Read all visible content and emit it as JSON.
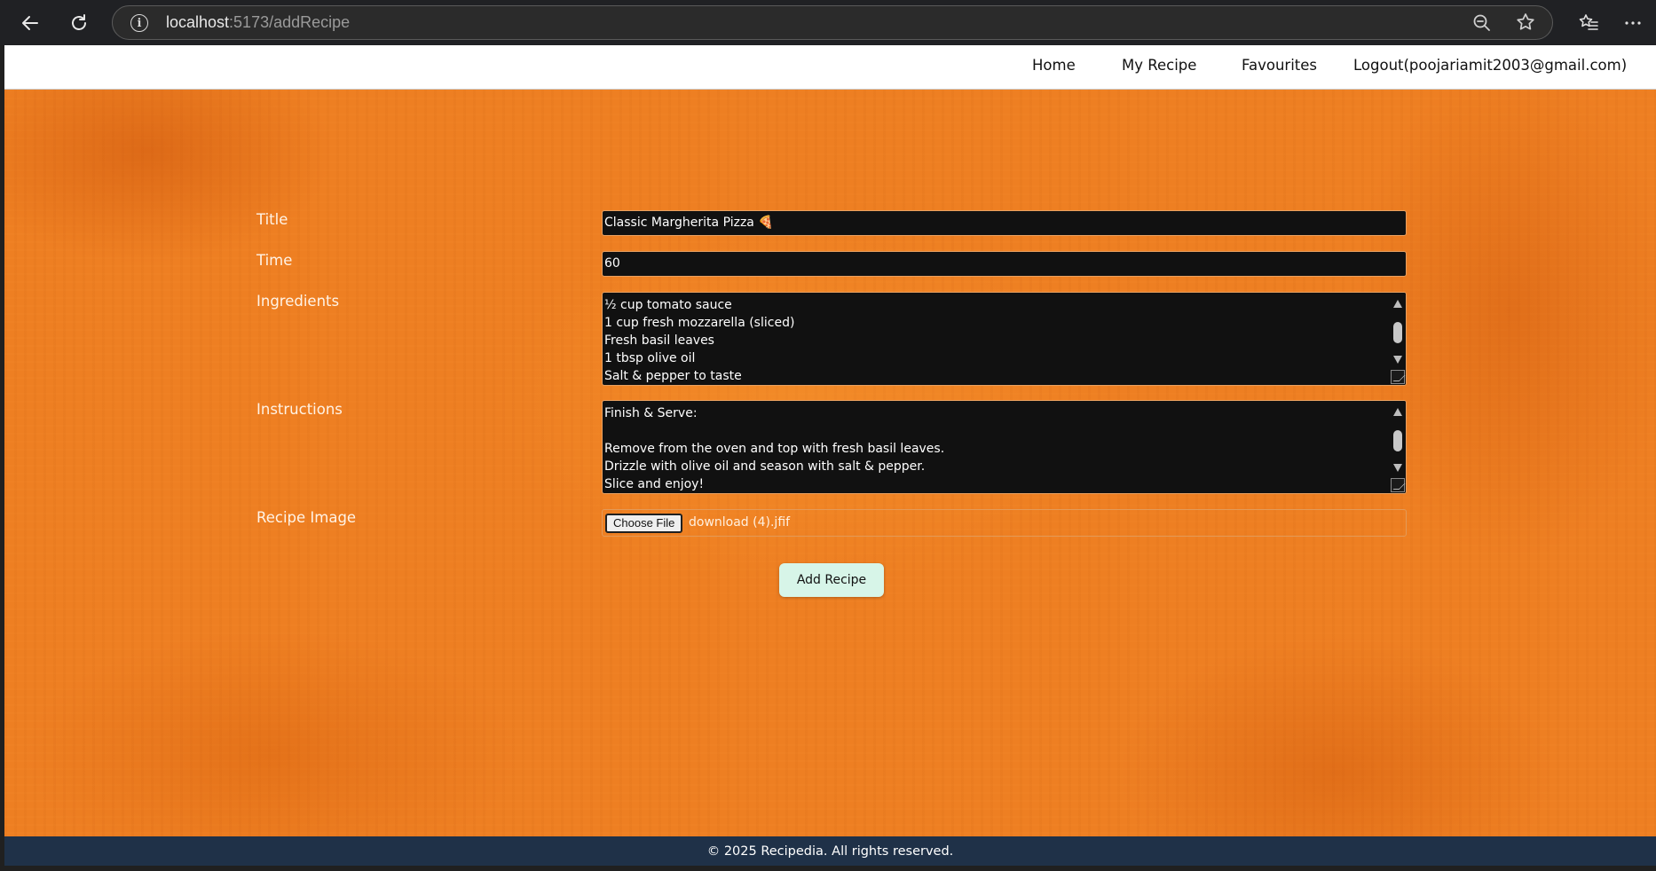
{
  "browser": {
    "url_host": "localhost",
    "url_path": ":5173/addRecipe",
    "icons": [
      "back-arrow-icon",
      "reload-icon",
      "info-icon",
      "zoom-out-icon",
      "star-icon",
      "favorites-icon",
      "more-icon"
    ]
  },
  "navbar": {
    "links": [
      {
        "label": "Home"
      },
      {
        "label": "My Recipe"
      },
      {
        "label": "Favourites"
      },
      {
        "label": "Logout(poojariamit2003@gmail.com)"
      }
    ]
  },
  "form": {
    "title_label": "Title",
    "title_value": "Classic Margherita Pizza 🍕",
    "time_label": "Time",
    "time_value": "60",
    "ingredients_label": "Ingredients",
    "ingredients_lines": [
      "½ cup tomato sauce",
      "1 cup fresh mozzarella (sliced)",
      "Fresh basil leaves",
      "1 tbsp olive oil",
      "Salt & pepper to taste"
    ],
    "instructions_label": "Instructions",
    "instructions_lines": [
      "Finish & Serve:",
      "",
      "Remove from the oven and top with fresh basil leaves.",
      "Drizzle with olive oil and season with salt & pepper.",
      "Slice and enjoy!"
    ],
    "image_label": "Recipe Image",
    "choose_file_label": "Choose File",
    "file_name": "download (4).jfif",
    "submit_label": "Add Recipe"
  },
  "footer": {
    "text": "© 2025 Recipedia. All rights reserved."
  },
  "colors": {
    "background_orange": "#ee7f22",
    "navbar_bg": "#ffffff",
    "field_bg": "#111111",
    "button_bg": "#d7f5e8",
    "footer_bg": "#1f3148"
  }
}
